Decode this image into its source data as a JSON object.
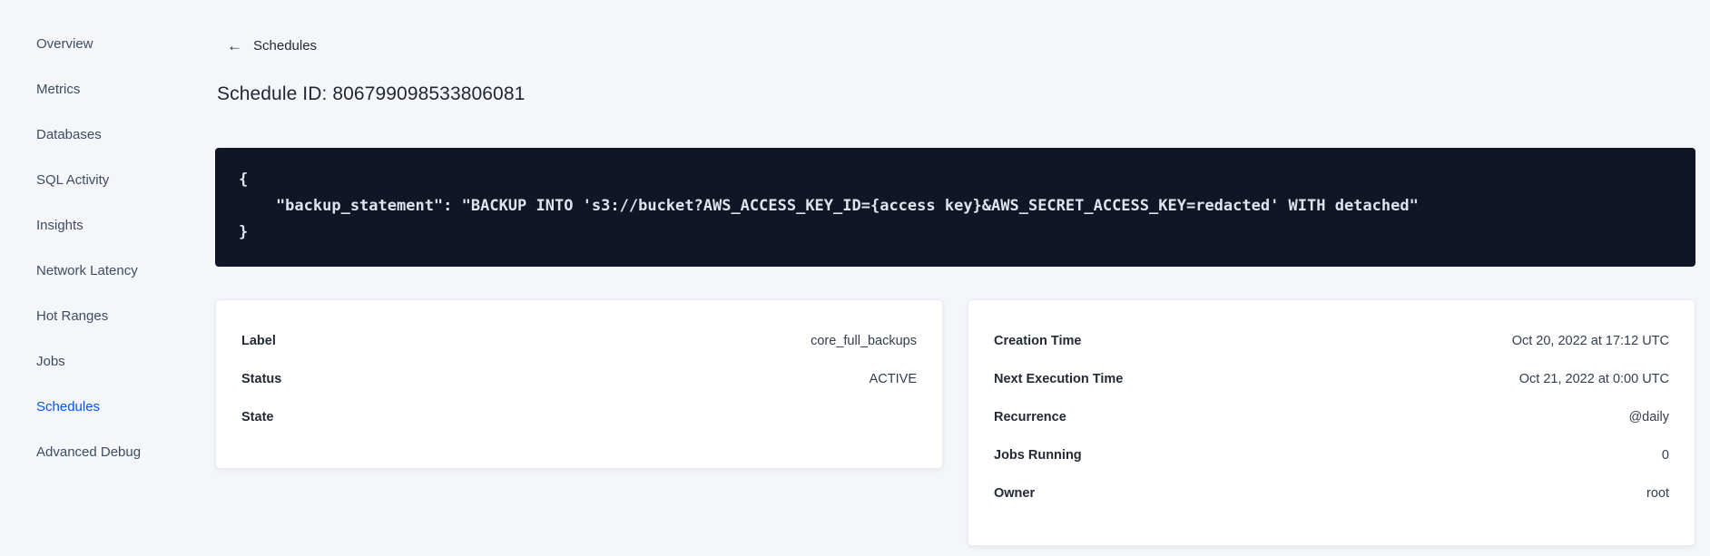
{
  "colors": {
    "accent_blue": "#0055ff",
    "page_background": "#f4f6fa",
    "code_background": "#101626",
    "card_background": "#ffffff",
    "sidebar_text": "#3f4c63",
    "text_dark": "#242a35"
  },
  "sidebar": {
    "items": [
      {
        "label": "Overview",
        "active": false
      },
      {
        "label": "Metrics",
        "active": false
      },
      {
        "label": "Databases",
        "active": false
      },
      {
        "label": "SQL Activity",
        "active": false
      },
      {
        "label": "Insights",
        "active": false
      },
      {
        "label": "Network Latency",
        "active": false
      },
      {
        "label": "Hot Ranges",
        "active": false
      },
      {
        "label": "Jobs",
        "active": false
      },
      {
        "label": "Schedules",
        "active": true
      },
      {
        "label": "Advanced Debug",
        "active": false
      }
    ]
  },
  "header": {
    "back_arrow": "←",
    "back_label": "Schedules",
    "title": "Schedule ID: 806799098533806081"
  },
  "code_block": {
    "lines": [
      "{",
      "    \"backup_statement\": \"BACKUP INTO 's3://bucket?AWS_ACCESS_KEY_ID={access key}&AWS_SECRET_ACCESS_KEY=redacted' WITH detached\"",
      "}"
    ]
  },
  "details_card": {
    "rows": [
      {
        "label": "Label",
        "value": "core_full_backups"
      },
      {
        "label": "Status",
        "value": "ACTIVE"
      },
      {
        "label": "State",
        "value": ""
      }
    ]
  },
  "schedule_card": {
    "rows": [
      {
        "label": "Creation Time",
        "value": "Oct 20, 2022 at 17:12 UTC"
      },
      {
        "label": "Next Execution Time",
        "value": "Oct 21, 2022 at 0:00 UTC"
      },
      {
        "label": "Recurrence",
        "value": "@daily"
      },
      {
        "label": "Jobs Running",
        "value": "0"
      },
      {
        "label": "Owner",
        "value": "root"
      }
    ]
  }
}
